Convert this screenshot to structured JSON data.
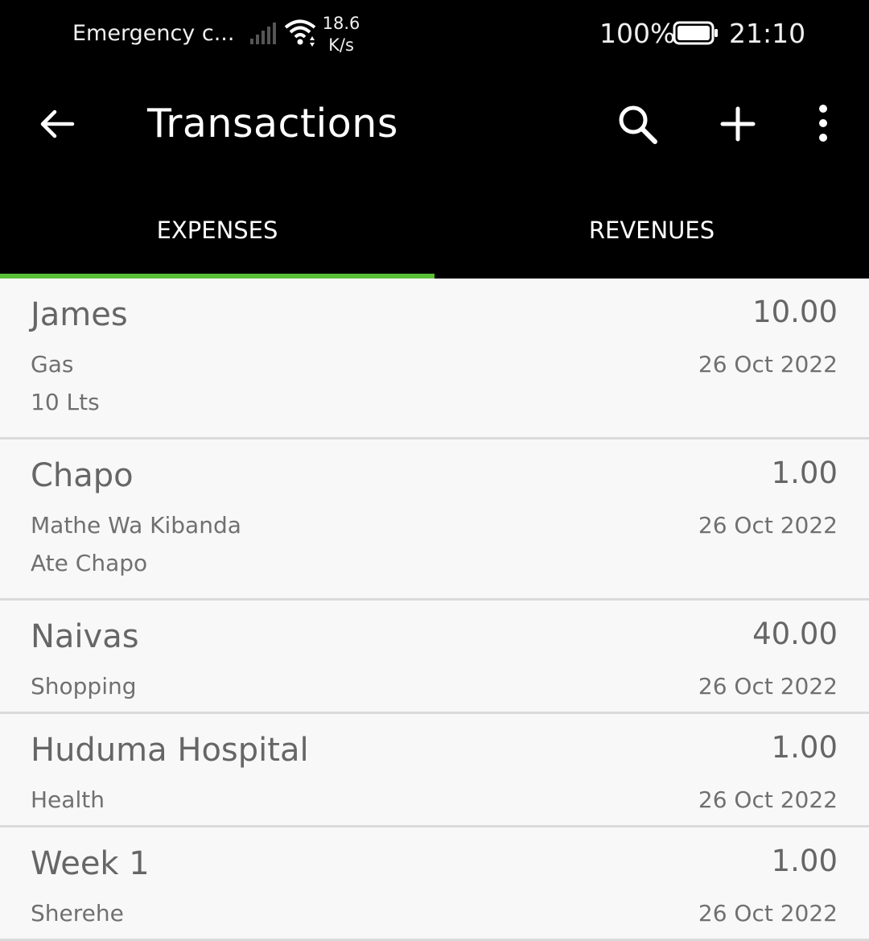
{
  "status_bar": {
    "carrier": "Emergency c...",
    "speed_value": "18.6",
    "speed_unit": "K/s",
    "battery": "100%",
    "time": "21:10"
  },
  "app_bar": {
    "title": "Transactions",
    "icons": [
      "back-arrow-icon",
      "search-icon",
      "add-icon",
      "more-vert-icon"
    ]
  },
  "tabs": [
    {
      "label": "EXPENSES",
      "selected": true
    },
    {
      "label": "REVENUES",
      "selected": false
    }
  ],
  "colors": {
    "accent": "#5ac036",
    "bar_background": "#000000",
    "list_background": "#f8f8f8"
  },
  "transactions": [
    {
      "name": "James",
      "amount": "10.00",
      "category": "Gas",
      "date": "26 Oct 2022",
      "note": "10 Lts"
    },
    {
      "name": "Chapo",
      "amount": "1.00",
      "category": "Mathe Wa Kibanda",
      "date": "26 Oct 2022",
      "note": "Ate Chapo"
    },
    {
      "name": "Naivas",
      "amount": "40.00",
      "category": "Shopping",
      "date": "26 Oct 2022",
      "note": ""
    },
    {
      "name": "Huduma Hospital",
      "amount": "1.00",
      "category": "Health",
      "date": "26 Oct 2022",
      "note": ""
    },
    {
      "name": "Week 1",
      "amount": "1.00",
      "category": "Sherehe",
      "date": "26 Oct 2022",
      "note": ""
    }
  ]
}
